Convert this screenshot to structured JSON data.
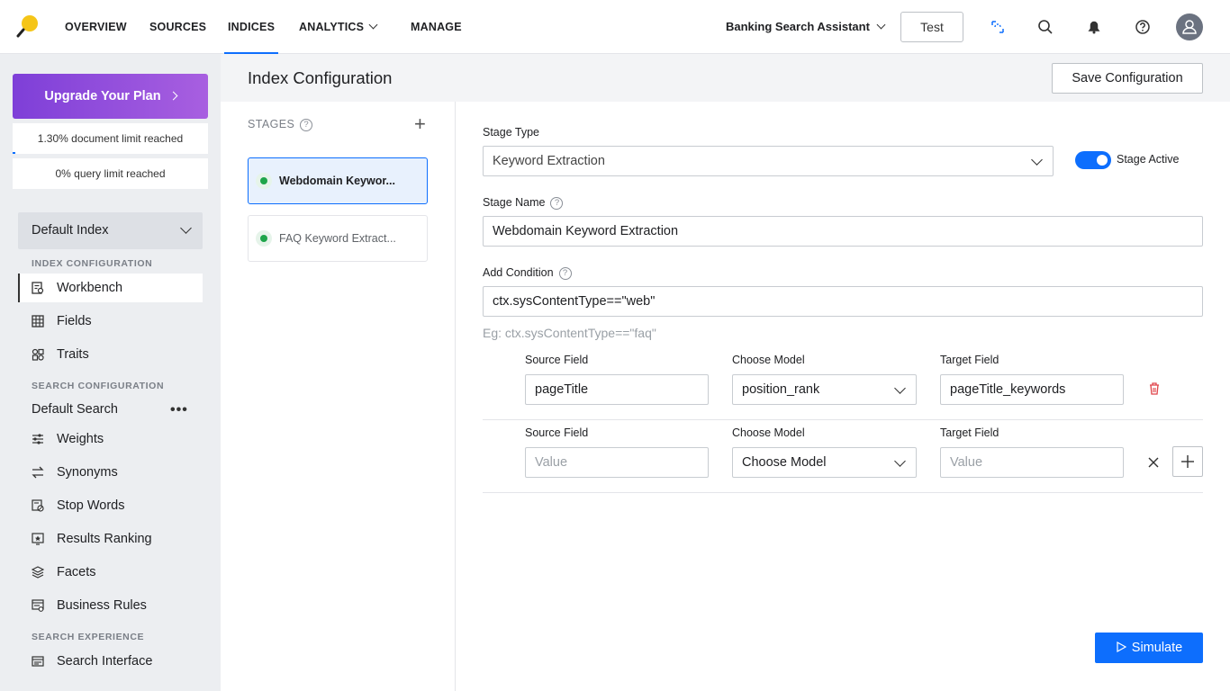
{
  "nav": {
    "items": [
      "OVERVIEW",
      "SOURCES",
      "INDICES",
      "ANALYTICS",
      "MANAGE"
    ],
    "active": "INDICES",
    "app_name": "Banking Search Assistant",
    "test_label": "Test",
    "icons": [
      "sync-icon",
      "search-icon",
      "bell-icon",
      "help-icon",
      "user-avatar-icon"
    ]
  },
  "sidebar": {
    "upgrade_label": "Upgrade Your Plan",
    "doc_limit": "1.30% document limit reached",
    "doc_limit_fraction": 0.013,
    "query_limit": "0% query limit reached",
    "index_select": "Default Index",
    "sections": {
      "index_config": "INDEX CONFIGURATION",
      "search_config": "SEARCH CONFIGURATION",
      "search_experience": "SEARCH EXPERIENCE"
    },
    "index_items": [
      {
        "label": "Workbench",
        "icon": "workbench-icon"
      },
      {
        "label": "Fields",
        "icon": "grid-icon"
      },
      {
        "label": "Traits",
        "icon": "traits-icon"
      }
    ],
    "default_search": "Default Search",
    "search_items": [
      {
        "label": "Weights",
        "icon": "sliders-icon"
      },
      {
        "label": "Synonyms",
        "icon": "swap-icon"
      },
      {
        "label": "Stop Words",
        "icon": "stop-words-icon"
      },
      {
        "label": "Results Ranking",
        "icon": "ranking-icon"
      },
      {
        "label": "Facets",
        "icon": "layers-icon"
      },
      {
        "label": "Business Rules",
        "icon": "rules-icon"
      }
    ],
    "experience_items": [
      {
        "label": "Search Interface",
        "icon": "interface-icon"
      }
    ]
  },
  "main": {
    "title": "Index Configuration",
    "save_label": "Save Configuration",
    "stages_label": "STAGES",
    "stages": [
      {
        "label": "Webdomain Keywor...",
        "active": true
      },
      {
        "label": "FAQ Keyword Extract...",
        "active": false
      }
    ],
    "form": {
      "stage_type_label": "Stage Type",
      "stage_type_value": "Keyword Extraction",
      "stage_active_label": "Stage Active",
      "stage_active": true,
      "stage_name_label": "Stage Name",
      "stage_name_value": "Webdomain Keyword Extraction",
      "condition_label": "Add Condition",
      "condition_value": "ctx.sysContentType==\"web\"",
      "condition_hint": "Eg: ctx.sysContentType==\"faq\"",
      "mapping_rows": [
        {
          "source_label": "Source Field",
          "source_value": "pageTitle",
          "model_label": "Choose Model",
          "model_value": "position_rank",
          "target_label": "Target Field",
          "target_value": "pageTitle_keywords"
        },
        {
          "source_label": "Source Field",
          "source_placeholder": "Value",
          "model_label": "Choose Model",
          "model_value": "Choose Model",
          "target_label": "Target Field",
          "target_placeholder": "Value"
        }
      ]
    },
    "simulate_label": "Simulate"
  }
}
